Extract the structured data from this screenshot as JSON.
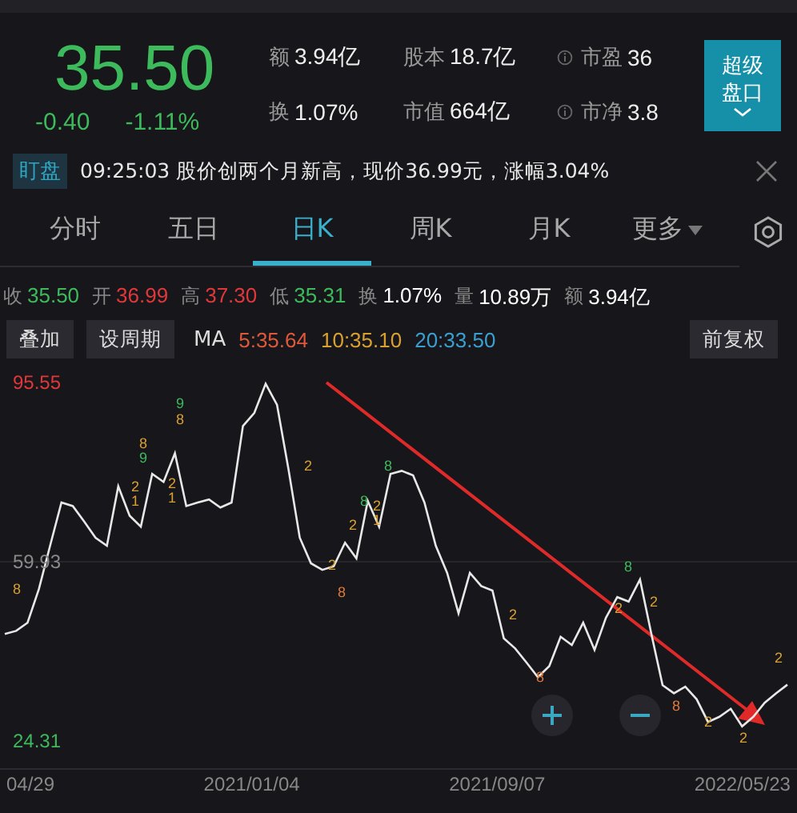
{
  "quote": {
    "price": "35.50",
    "change": "-0.40",
    "change_pct": "-1.11%"
  },
  "stats": [
    {
      "label": "额",
      "value": "3.94亿",
      "info": false
    },
    {
      "label": "股本",
      "value": "18.7亿",
      "info": false
    },
    {
      "label": "市盈",
      "value": "36",
      "info": true
    },
    {
      "label": "换",
      "value": "1.07%",
      "info": false
    },
    {
      "label": "市值",
      "value": "664亿",
      "info": false
    },
    {
      "label": "市净",
      "value": "3.8",
      "info": true
    }
  ],
  "super_button": {
    "label": "超级盘口"
  },
  "ticker": {
    "badge": "盯盘",
    "text": "09:25:03 股价创两个月新高，现价36.99元，涨幅3.04%"
  },
  "tabs": [
    {
      "label": "分时",
      "selected": false,
      "kind": "plain"
    },
    {
      "label": "五日",
      "selected": false,
      "kind": "plain"
    },
    {
      "label": "日K",
      "selected": true,
      "kind": "plain"
    },
    {
      "label": "周K",
      "selected": false,
      "kind": "plain"
    },
    {
      "label": "月K",
      "selected": false,
      "kind": "plain"
    },
    {
      "label": "更多",
      "selected": false,
      "kind": "menu"
    }
  ],
  "summary": [
    {
      "label": "收",
      "value": "35.50",
      "color": "#3dba5c"
    },
    {
      "label": "开",
      "value": "36.99",
      "color": "#e0383a"
    },
    {
      "label": "高",
      "value": "37.30",
      "color": "#e0383a"
    },
    {
      "label": "低",
      "value": "35.31",
      "color": "#3dba5c"
    },
    {
      "label": "换",
      "value": "1.07%",
      "color": "#ffffff"
    },
    {
      "label": "量",
      "value": "10.89万",
      "color": "#ffffff"
    },
    {
      "label": "额",
      "value": "3.94亿",
      "color": "#ffffff"
    }
  ],
  "toolbar": {
    "left_buttons": [
      "叠加",
      "设周期"
    ],
    "ma_label": "MA",
    "ma": [
      {
        "text": "5:35.64",
        "color": "#e0583a"
      },
      {
        "text": "10:35.10",
        "color": "#d9a030"
      },
      {
        "text": "20:33.50",
        "color": "#3a9fd0"
      }
    ],
    "right_button": "前复权"
  },
  "chart": {
    "chart_data": {
      "type": "line",
      "ylim": [
        24.31,
        95.55
      ],
      "yticks": [
        {
          "value": 95.55,
          "label": "95.55"
        },
        {
          "value": 59.93,
          "label": "59.93"
        },
        {
          "value": 24.31,
          "label": "24.31"
        }
      ],
      "series": [
        {
          "color": "#e8e8e8",
          "values": [
            45.6,
            46.2,
            47.8,
            54.5,
            63.1,
            71.7,
            71.0,
            67.9,
            64.7,
            63.1,
            74.9,
            69.1,
            66.9,
            77.4,
            75.8,
            81.5,
            71.0,
            71.7,
            72.3,
            70.7,
            71.7,
            86.9,
            89.5,
            95.3,
            91.1,
            78.4,
            64.7,
            59.6,
            58.3,
            59.0,
            63.7,
            60.6,
            72.0,
            66.9,
            77.4,
            78.0,
            77.1,
            71.7,
            63.1,
            57.7,
            49.7,
            57.7,
            55.1,
            54.2,
            44.7,
            42.7,
            39.9,
            37.0,
            39.2,
            45.0,
            43.4,
            47.8,
            42.4,
            48.8,
            52.9,
            52.0,
            56.4,
            45.6,
            35.4,
            33.8,
            35.1,
            32.6,
            28.1,
            29.1,
            30.7,
            27.2,
            29.1,
            31.9,
            33.8,
            35.5
          ]
        }
      ]
    },
    "x_labels": [
      "04/29",
      "2021/01/04",
      "2021/09/07",
      "2022/05/23"
    ],
    "signals": [
      {
        "text": "8",
        "color": "#d9a030"
      },
      {
        "text": "9",
        "color": "#3dba5c"
      },
      {
        "text": "8",
        "color": "#d9a030"
      },
      {
        "text": "8",
        "color": "#d9a030"
      },
      {
        "text": "9",
        "color": "#3dba5c"
      },
      {
        "text": "2",
        "color": "#d9a030"
      },
      {
        "text": "1",
        "color": "#d9a030"
      },
      {
        "text": "2",
        "color": "#d9a030"
      },
      {
        "text": "1",
        "color": "#d9a030"
      },
      {
        "text": "2",
        "color": "#d9a030"
      },
      {
        "text": "8",
        "color": "#3dba5c"
      },
      {
        "text": "8",
        "color": "#3dba5c"
      },
      {
        "text": "2",
        "color": "#d9a030"
      },
      {
        "text": "1",
        "color": "#d9a030"
      },
      {
        "text": "2",
        "color": "#d9a030"
      },
      {
        "text": "2",
        "color": "#d9a030"
      },
      {
        "text": "8",
        "color": "#e07a3a"
      },
      {
        "text": "2",
        "color": "#d9a030"
      },
      {
        "text": "8",
        "color": "#e07a3a"
      },
      {
        "text": "8",
        "color": "#3dba5c"
      },
      {
        "text": "2",
        "color": "#d9a030"
      },
      {
        "text": "2",
        "color": "#d9a030"
      },
      {
        "text": "8",
        "color": "#e07a3a"
      },
      {
        "text": "2",
        "color": "#d9a030"
      },
      {
        "text": "2",
        "color": "#d9a030"
      },
      {
        "text": "2",
        "color": "#d9a030"
      }
    ]
  }
}
